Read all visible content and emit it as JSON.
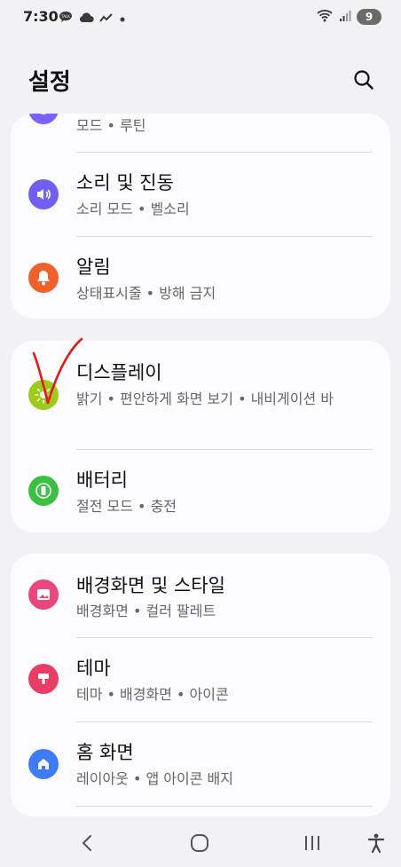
{
  "status": {
    "time": "7:30",
    "battery_level": "9",
    "left_icons": [
      "talk-icon",
      "cloud-icon",
      "trend-icon",
      "dot-icon"
    ],
    "right_icons": [
      "wifi-icon",
      "signal-icon",
      "battery-icon"
    ]
  },
  "header": {
    "title": "설정",
    "search_icon": "search-icon"
  },
  "settings": {
    "partial_item": {
      "sub": "모드 • 루틴",
      "icon": "routine-icon",
      "color": "#7b61ff"
    },
    "sound": {
      "title": "소리 및 진동",
      "sub": "소리 모드 • 벨소리",
      "icon": "volume-icon",
      "color": "#7060f2"
    },
    "notifications": {
      "title": "알림",
      "sub": "상태표시줄 • 방해 금지",
      "icon": "bell-icon",
      "color": "#f0602a"
    },
    "display": {
      "title": "디스플레이",
      "sub": "밝기 • 편안하게 화면 보기 • 내비게이션 바",
      "icon": "brightness-icon",
      "color": "#9ccb1c"
    },
    "battery": {
      "title": "배터리",
      "sub": "절전 모드 • 충전",
      "icon": "battery-care-icon",
      "color": "#3bbf45"
    },
    "wallpaper": {
      "title": "배경화면 및 스타일",
      "sub": "배경화면 • 컬러 팔레트",
      "icon": "image-icon",
      "color": "#e9467a"
    },
    "themes": {
      "title": "테마",
      "sub": "테마 • 배경화면 • 아이콘",
      "icon": "brush-icon",
      "color": "#e83e66"
    },
    "home": {
      "title": "홈 화면",
      "sub": "레이아웃 • 앱 아이콘 배지",
      "icon": "home-icon",
      "color": "#3d7cf4"
    }
  },
  "nav": {
    "back_icon": "back-icon",
    "home_icon": "home-button-icon",
    "recents_icon": "recents-icon",
    "accessibility_icon": "accessibility-icon"
  },
  "annotation": {
    "color": "#e01919",
    "icon": "checkmark-annotation"
  }
}
